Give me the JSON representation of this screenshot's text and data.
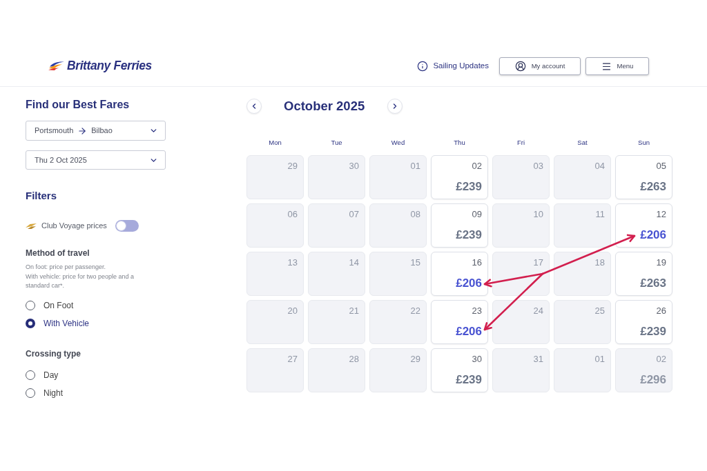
{
  "header": {
    "logo": "Brittany Ferries",
    "nav": [
      {
        "kind": "updates",
        "label": "Sailing Updates"
      },
      {
        "kind": "account",
        "label": "My account"
      },
      {
        "kind": "menu",
        "label": "Menu"
      }
    ]
  },
  "sidebar": {
    "title": "Find our Best Fares",
    "route": {
      "from": "Portsmouth",
      "to": "Bilbao"
    },
    "date": "Thu 2 Oct 2025",
    "filters_title": "Filters",
    "club_voyage": {
      "label": "Club Voyage prices",
      "on": false
    },
    "groups": [
      {
        "title": "Method of travel",
        "description": [
          "On foot: price per passenger.",
          "With vehicle: price for two people and a standard car*."
        ],
        "options": [
          {
            "label": "On Foot",
            "selected": false
          },
          {
            "label": "With Vehicle",
            "selected": true
          }
        ]
      },
      {
        "title": "Crossing type",
        "options": [
          {
            "label": "Day",
            "selected": false
          },
          {
            "label": "Night",
            "selected": false
          }
        ]
      }
    ]
  },
  "calendar": {
    "month": "October 2025",
    "weekdays": [
      "Mon",
      "Tue",
      "Wed",
      "Thu",
      "Fri",
      "Sat",
      "Sun"
    ],
    "days": [
      {
        "date": "29",
        "available": false,
        "highlighted": false
      },
      {
        "date": "30",
        "available": false,
        "highlighted": false
      },
      {
        "date": "01",
        "available": false,
        "highlighted": false
      },
      {
        "date": "02",
        "available": true,
        "highlighted": false,
        "price": "£239"
      },
      {
        "date": "03",
        "available": false,
        "highlighted": false
      },
      {
        "date": "04",
        "available": false,
        "highlighted": false
      },
      {
        "date": "05",
        "available": true,
        "highlighted": false,
        "price": "£263"
      },
      {
        "date": "06",
        "available": false,
        "highlighted": false
      },
      {
        "date": "07",
        "available": false,
        "highlighted": false
      },
      {
        "date": "08",
        "available": false,
        "highlighted": false
      },
      {
        "date": "09",
        "available": true,
        "highlighted": false,
        "price": "£239"
      },
      {
        "date": "10",
        "available": false,
        "highlighted": false
      },
      {
        "date": "11",
        "available": false,
        "highlighted": false
      },
      {
        "date": "12",
        "available": true,
        "highlighted": true,
        "price": "£206"
      },
      {
        "date": "13",
        "available": false,
        "highlighted": false
      },
      {
        "date": "14",
        "available": false,
        "highlighted": false
      },
      {
        "date": "15",
        "available": false,
        "highlighted": false
      },
      {
        "date": "16",
        "available": true,
        "highlighted": true,
        "price": "£206"
      },
      {
        "date": "17",
        "available": false,
        "highlighted": false
      },
      {
        "date": "18",
        "available": false,
        "highlighted": false
      },
      {
        "date": "19",
        "available": true,
        "highlighted": false,
        "price": "£263"
      },
      {
        "date": "20",
        "available": false,
        "highlighted": false
      },
      {
        "date": "21",
        "available": false,
        "highlighted": false
      },
      {
        "date": "22",
        "available": false,
        "highlighted": false
      },
      {
        "date": "23",
        "available": true,
        "highlighted": true,
        "price": "£206"
      },
      {
        "date": "24",
        "available": false,
        "highlighted": false
      },
      {
        "date": "25",
        "available": false,
        "highlighted": false
      },
      {
        "date": "26",
        "available": true,
        "highlighted": false,
        "price": "£239"
      },
      {
        "date": "27",
        "available": false,
        "highlighted": false
      },
      {
        "date": "28",
        "available": false,
        "highlighted": false
      },
      {
        "date": "29",
        "available": false,
        "highlighted": false
      },
      {
        "date": "30",
        "available": true,
        "highlighted": false,
        "price": "£239"
      },
      {
        "date": "31",
        "available": false,
        "highlighted": false
      },
      {
        "date": "01",
        "available": false,
        "highlighted": false
      },
      {
        "date": "02",
        "available": false,
        "highlighted": false,
        "price": "£296"
      }
    ]
  }
}
